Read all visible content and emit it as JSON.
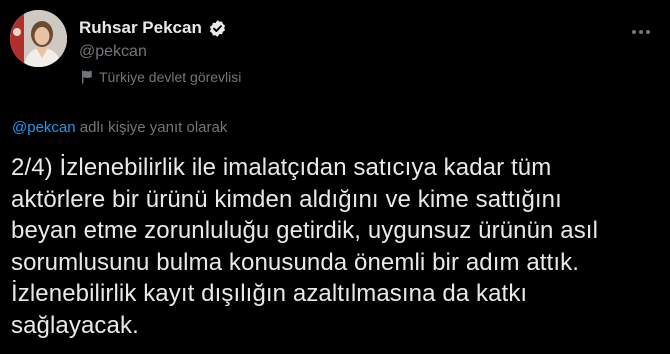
{
  "author": {
    "display_name": "Ruhsar Pekcan",
    "handle": "@pekcan",
    "account_label": "Türkiye devlet görevlisi",
    "avatar_icon": "profile-photo",
    "verified_icon": "verified-badge-icon",
    "label_icon": "government-flag-icon"
  },
  "reply": {
    "mention": "@pekcan",
    "suffix": " adlı kişiye yanıt olarak"
  },
  "tweet": {
    "lines": [
      "2/4) İzlenebilirlik ile imalatçıdan satıcıya kadar tüm",
      "aktörlere bir ürünü kimden aldığını ve kime sattığını",
      "beyan etme zorunluluğu getirdik, uygunsuz ürünün asıl",
      "sorumlusunu bulma konusunda önemli bir adım attık.",
      "İzlenebilirlik kayıt dışılığın azaltılmasına da katkı",
      "sağlayacak."
    ]
  },
  "colors": {
    "background": "#000000",
    "text": "#e7e9ea",
    "secondary": "#71767b",
    "accent": "#1d9bf0"
  }
}
